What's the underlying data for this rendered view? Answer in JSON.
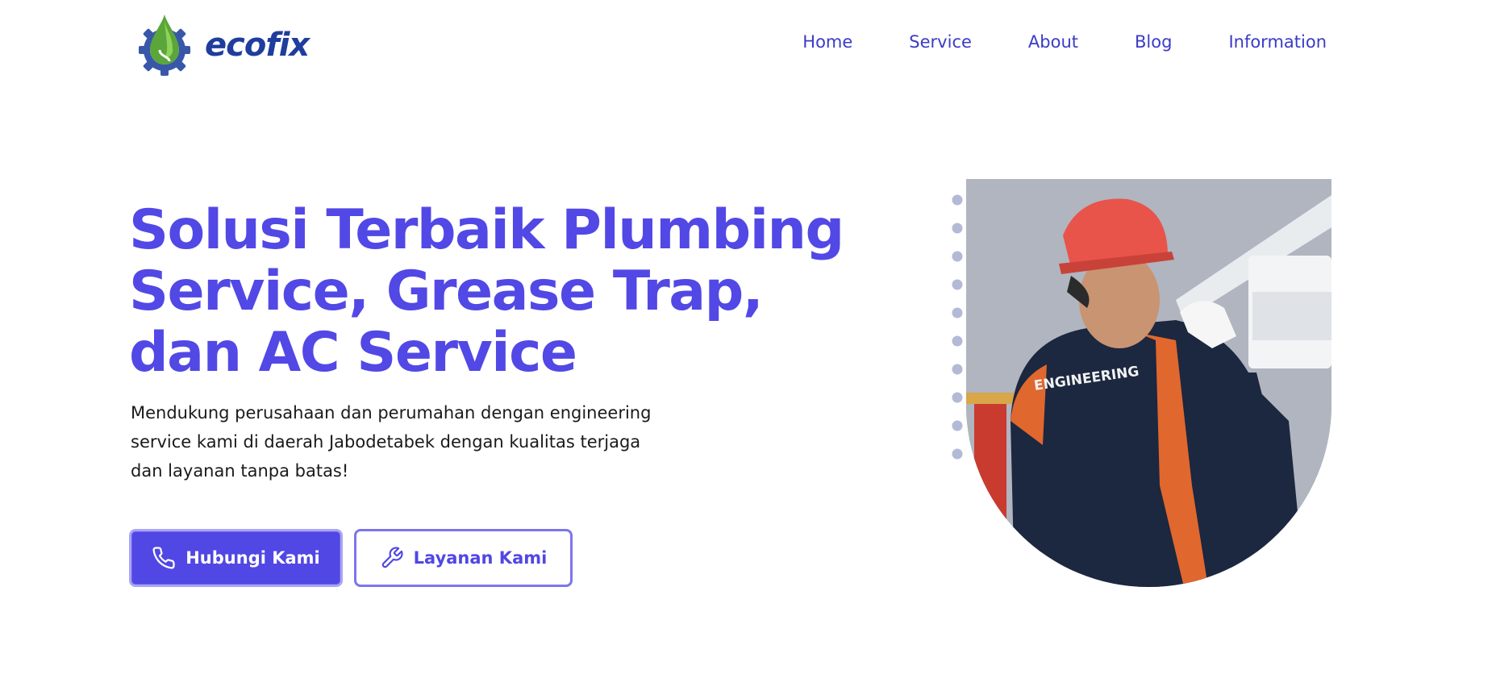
{
  "header": {
    "brand": "ecofix",
    "nav": [
      "Home",
      "Service",
      "About",
      "Blog",
      "Information"
    ]
  },
  "hero": {
    "title": "Solusi Terbaik Plumbing Service, Grease Trap, dan AC Service",
    "description": "Mendukung perusahaan dan perumahan dengan engineering service kami di daerah Jabodetabek dengan kualitas terjaga dan layanan tanpa batas!",
    "primary_button": "Hubungi Kami",
    "secondary_button": "Layanan Kami",
    "photo_jacket_text": "ENGINEERING"
  },
  "colors": {
    "accent": "#5248e5",
    "nav": "#3b3bc8",
    "brand": "#1f3d9e",
    "dots": "#b3bad6"
  },
  "icons": {
    "logo": "gear-droplet-icon",
    "primary_button": "phone-icon",
    "secondary_button": "wrench-icon"
  }
}
